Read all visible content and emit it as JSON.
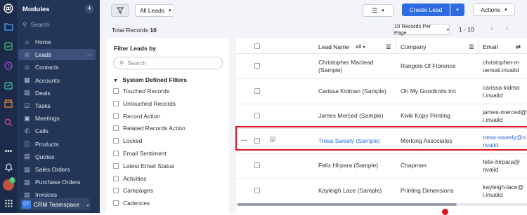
{
  "sidebar": {
    "title": "Modules",
    "search_placeholder": "Search",
    "items": [
      {
        "label": "Home",
        "icon": "home-icon"
      },
      {
        "label": "Leads",
        "icon": "leads-icon",
        "active": true
      },
      {
        "label": "Contacts",
        "icon": "contacts-icon"
      },
      {
        "label": "Accounts",
        "icon": "accounts-icon"
      },
      {
        "label": "Deals",
        "icon": "deals-icon"
      },
      {
        "label": "Tasks",
        "icon": "tasks-icon"
      },
      {
        "label": "Meetings",
        "icon": "meetings-icon"
      },
      {
        "label": "Calls",
        "icon": "calls-icon"
      },
      {
        "label": "Products",
        "icon": "products-icon"
      },
      {
        "label": "Quotes",
        "icon": "quotes-icon"
      },
      {
        "label": "Sales Orders",
        "icon": "sales-orders-icon"
      },
      {
        "label": "Purchase Orders",
        "icon": "purchase-orders-icon"
      },
      {
        "label": "Invoices",
        "icon": "invoices-icon"
      }
    ],
    "team": {
      "badge": "CT",
      "label": "CRM Teamspace"
    }
  },
  "rail": {
    "notification_count": "1"
  },
  "toolbar": {
    "view": "All Leads",
    "create": "Create Lead",
    "actions": "Actions"
  },
  "subbar": {
    "total_label": "Total Records",
    "total_value": "10",
    "per_page": "10 Records Per Page",
    "range": "1 - 10"
  },
  "filters": {
    "title": "Filter Leads by",
    "search_placeholder": "Search",
    "section": "System Defined Filters",
    "items": [
      "Touched Records",
      "Untouched Records",
      "Record Action",
      "Related Records Action",
      "Locked",
      "Email Sentiment",
      "Latest Email Status",
      "Activities",
      "Campaigns",
      "Cadences"
    ]
  },
  "grid": {
    "headers": {
      "lead_name": "Lead Name",
      "filter": "All",
      "company": "Company",
      "email": "Email"
    },
    "rows": [
      {
        "name1": "Christopher Maclead",
        "name2": "(Sample)",
        "company": "Rangoni Of Florence",
        "email1": "christopher-m",
        "email2": "oemail.invalid"
      },
      {
        "name1": "Carissa Kidman (Sample)",
        "name2": "",
        "company": "Oh My Goodknits Inc",
        "email1": "carissa-kidma",
        "email2": "l.invalid"
      },
      {
        "name1": "James Merced (Sample)",
        "name2": "",
        "company": "Kwik Kopy Printing",
        "email1": "james-merced@",
        "email2": "l.invalid"
      },
      {
        "name1": "Tresa Sweely (Sample)",
        "name2": "",
        "company": "Morlong Associates",
        "email1": "tresa-sweely@n",
        "email2": "nvalid",
        "selected": true
      },
      {
        "name1": "Felix Hirpara (Sample)",
        "name2": "",
        "company": "Chapman",
        "email1": "felix-hirpara@",
        "email2": "nvalid"
      },
      {
        "name1": "Kayleigh Lace (Sample)",
        "name2": "",
        "company": "Printing Dimensions",
        "email1": "kayleigh-lace@",
        "email2": "l.invalid"
      }
    ]
  },
  "colors": {
    "accent": "#2f6be0",
    "sidebar": "#243657",
    "rail": "#1c2b4a",
    "highlight": "#e0141e"
  }
}
